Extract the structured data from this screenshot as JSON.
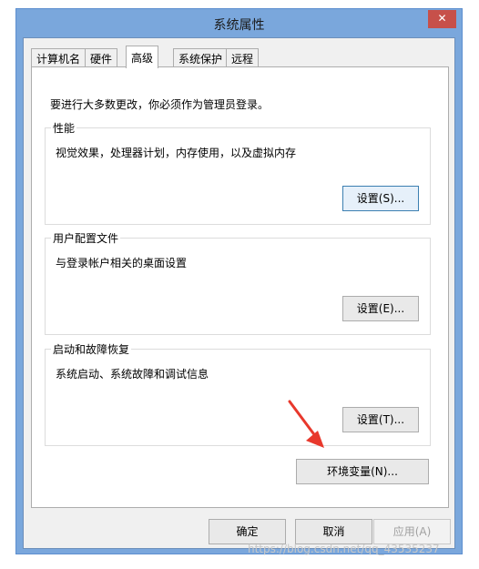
{
  "window": {
    "title": "系统属性",
    "close_label": "✕"
  },
  "tabs": [
    {
      "label": "计算机名",
      "active": false
    },
    {
      "label": "硬件",
      "active": false
    },
    {
      "label": "高级",
      "active": true
    },
    {
      "label": "系统保护",
      "active": false
    },
    {
      "label": "远程",
      "active": false
    }
  ],
  "advanced": {
    "intro": "要进行大多数更改，你必须作为管理员登录。",
    "performance": {
      "title": "性能",
      "description": "视觉效果，处理器计划，内存使用，以及虚拟内存",
      "button": "设置(S)..."
    },
    "user_profiles": {
      "title": "用户配置文件",
      "description": "与登录帐户相关的桌面设置",
      "button": "设置(E)..."
    },
    "startup_recovery": {
      "title": "启动和故障恢复",
      "description": "系统启动、系统故障和调试信息",
      "button": "设置(T)..."
    },
    "env_button": "环境变量(N)..."
  },
  "footer": {
    "ok": "确定",
    "cancel": "取消",
    "apply": "应用(A)"
  },
  "annotation": {
    "arrow_icon": "red-arrow-icon",
    "arrow_color": "#e8382c"
  },
  "watermark": "https://blog.csdn.net/qq_43535237"
}
